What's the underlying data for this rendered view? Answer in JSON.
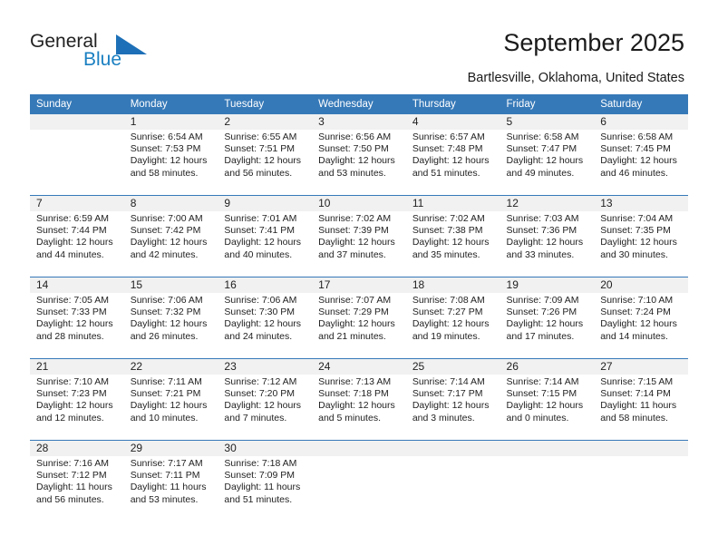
{
  "brand": {
    "line1": "General",
    "line2": "Blue",
    "triangle_icon": "triangle-icon",
    "color_primary": "#1d70b7",
    "color_text": "#222222"
  },
  "header": {
    "title": "September 2025",
    "location": "Bartlesville, Oklahoma, United States"
  },
  "calendar": {
    "header_bg": "#3679b8",
    "daynum_bg": "#f1f1f1",
    "weekday_headers": [
      "Sunday",
      "Monday",
      "Tuesday",
      "Wednesday",
      "Thursday",
      "Friday",
      "Saturday"
    ],
    "weeks": [
      [
        {
          "day": "",
          "sunrise": "",
          "sunset": "",
          "daylight1": "",
          "daylight2": ""
        },
        {
          "day": "1",
          "sunrise": "Sunrise: 6:54 AM",
          "sunset": "Sunset: 7:53 PM",
          "daylight1": "Daylight: 12 hours",
          "daylight2": "and 58 minutes."
        },
        {
          "day": "2",
          "sunrise": "Sunrise: 6:55 AM",
          "sunset": "Sunset: 7:51 PM",
          "daylight1": "Daylight: 12 hours",
          "daylight2": "and 56 minutes."
        },
        {
          "day": "3",
          "sunrise": "Sunrise: 6:56 AM",
          "sunset": "Sunset: 7:50 PM",
          "daylight1": "Daylight: 12 hours",
          "daylight2": "and 53 minutes."
        },
        {
          "day": "4",
          "sunrise": "Sunrise: 6:57 AM",
          "sunset": "Sunset: 7:48 PM",
          "daylight1": "Daylight: 12 hours",
          "daylight2": "and 51 minutes."
        },
        {
          "day": "5",
          "sunrise": "Sunrise: 6:58 AM",
          "sunset": "Sunset: 7:47 PM",
          "daylight1": "Daylight: 12 hours",
          "daylight2": "and 49 minutes."
        },
        {
          "day": "6",
          "sunrise": "Sunrise: 6:58 AM",
          "sunset": "Sunset: 7:45 PM",
          "daylight1": "Daylight: 12 hours",
          "daylight2": "and 46 minutes."
        }
      ],
      [
        {
          "day": "7",
          "sunrise": "Sunrise: 6:59 AM",
          "sunset": "Sunset: 7:44 PM",
          "daylight1": "Daylight: 12 hours",
          "daylight2": "and 44 minutes."
        },
        {
          "day": "8",
          "sunrise": "Sunrise: 7:00 AM",
          "sunset": "Sunset: 7:42 PM",
          "daylight1": "Daylight: 12 hours",
          "daylight2": "and 42 minutes."
        },
        {
          "day": "9",
          "sunrise": "Sunrise: 7:01 AM",
          "sunset": "Sunset: 7:41 PM",
          "daylight1": "Daylight: 12 hours",
          "daylight2": "and 40 minutes."
        },
        {
          "day": "10",
          "sunrise": "Sunrise: 7:02 AM",
          "sunset": "Sunset: 7:39 PM",
          "daylight1": "Daylight: 12 hours",
          "daylight2": "and 37 minutes."
        },
        {
          "day": "11",
          "sunrise": "Sunrise: 7:02 AM",
          "sunset": "Sunset: 7:38 PM",
          "daylight1": "Daylight: 12 hours",
          "daylight2": "and 35 minutes."
        },
        {
          "day": "12",
          "sunrise": "Sunrise: 7:03 AM",
          "sunset": "Sunset: 7:36 PM",
          "daylight1": "Daylight: 12 hours",
          "daylight2": "and 33 minutes."
        },
        {
          "day": "13",
          "sunrise": "Sunrise: 7:04 AM",
          "sunset": "Sunset: 7:35 PM",
          "daylight1": "Daylight: 12 hours",
          "daylight2": "and 30 minutes."
        }
      ],
      [
        {
          "day": "14",
          "sunrise": "Sunrise: 7:05 AM",
          "sunset": "Sunset: 7:33 PM",
          "daylight1": "Daylight: 12 hours",
          "daylight2": "and 28 minutes."
        },
        {
          "day": "15",
          "sunrise": "Sunrise: 7:06 AM",
          "sunset": "Sunset: 7:32 PM",
          "daylight1": "Daylight: 12 hours",
          "daylight2": "and 26 minutes."
        },
        {
          "day": "16",
          "sunrise": "Sunrise: 7:06 AM",
          "sunset": "Sunset: 7:30 PM",
          "daylight1": "Daylight: 12 hours",
          "daylight2": "and 24 minutes."
        },
        {
          "day": "17",
          "sunrise": "Sunrise: 7:07 AM",
          "sunset": "Sunset: 7:29 PM",
          "daylight1": "Daylight: 12 hours",
          "daylight2": "and 21 minutes."
        },
        {
          "day": "18",
          "sunrise": "Sunrise: 7:08 AM",
          "sunset": "Sunset: 7:27 PM",
          "daylight1": "Daylight: 12 hours",
          "daylight2": "and 19 minutes."
        },
        {
          "day": "19",
          "sunrise": "Sunrise: 7:09 AM",
          "sunset": "Sunset: 7:26 PM",
          "daylight1": "Daylight: 12 hours",
          "daylight2": "and 17 minutes."
        },
        {
          "day": "20",
          "sunrise": "Sunrise: 7:10 AM",
          "sunset": "Sunset: 7:24 PM",
          "daylight1": "Daylight: 12 hours",
          "daylight2": "and 14 minutes."
        }
      ],
      [
        {
          "day": "21",
          "sunrise": "Sunrise: 7:10 AM",
          "sunset": "Sunset: 7:23 PM",
          "daylight1": "Daylight: 12 hours",
          "daylight2": "and 12 minutes."
        },
        {
          "day": "22",
          "sunrise": "Sunrise: 7:11 AM",
          "sunset": "Sunset: 7:21 PM",
          "daylight1": "Daylight: 12 hours",
          "daylight2": "and 10 minutes."
        },
        {
          "day": "23",
          "sunrise": "Sunrise: 7:12 AM",
          "sunset": "Sunset: 7:20 PM",
          "daylight1": "Daylight: 12 hours",
          "daylight2": "and 7 minutes."
        },
        {
          "day": "24",
          "sunrise": "Sunrise: 7:13 AM",
          "sunset": "Sunset: 7:18 PM",
          "daylight1": "Daylight: 12 hours",
          "daylight2": "and 5 minutes."
        },
        {
          "day": "25",
          "sunrise": "Sunrise: 7:14 AM",
          "sunset": "Sunset: 7:17 PM",
          "daylight1": "Daylight: 12 hours",
          "daylight2": "and 3 minutes."
        },
        {
          "day": "26",
          "sunrise": "Sunrise: 7:14 AM",
          "sunset": "Sunset: 7:15 PM",
          "daylight1": "Daylight: 12 hours",
          "daylight2": "and 0 minutes."
        },
        {
          "day": "27",
          "sunrise": "Sunrise: 7:15 AM",
          "sunset": "Sunset: 7:14 PM",
          "daylight1": "Daylight: 11 hours",
          "daylight2": "and 58 minutes."
        }
      ],
      [
        {
          "day": "28",
          "sunrise": "Sunrise: 7:16 AM",
          "sunset": "Sunset: 7:12 PM",
          "daylight1": "Daylight: 11 hours",
          "daylight2": "and 56 minutes."
        },
        {
          "day": "29",
          "sunrise": "Sunrise: 7:17 AM",
          "sunset": "Sunset: 7:11 PM",
          "daylight1": "Daylight: 11 hours",
          "daylight2": "and 53 minutes."
        },
        {
          "day": "30",
          "sunrise": "Sunrise: 7:18 AM",
          "sunset": "Sunset: 7:09 PM",
          "daylight1": "Daylight: 11 hours",
          "daylight2": "and 51 minutes."
        },
        {
          "day": "",
          "sunrise": "",
          "sunset": "",
          "daylight1": "",
          "daylight2": ""
        },
        {
          "day": "",
          "sunrise": "",
          "sunset": "",
          "daylight1": "",
          "daylight2": ""
        },
        {
          "day": "",
          "sunrise": "",
          "sunset": "",
          "daylight1": "",
          "daylight2": ""
        },
        {
          "day": "",
          "sunrise": "",
          "sunset": "",
          "daylight1": "",
          "daylight2": ""
        }
      ]
    ]
  }
}
